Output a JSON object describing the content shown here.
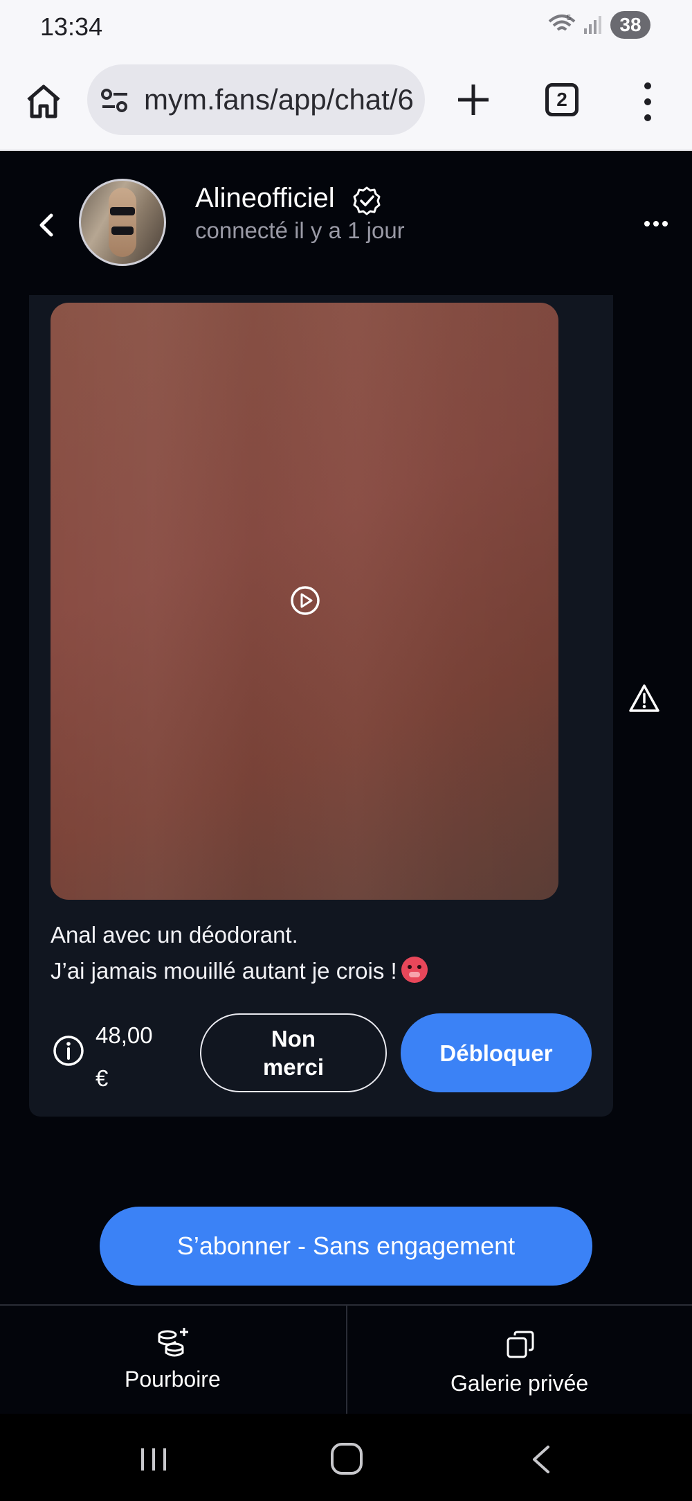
{
  "status_bar": {
    "time": "13:34",
    "battery": "38",
    "wifi_badge": "5"
  },
  "browser": {
    "url": "mym.fans/app/chat/6",
    "tab_count": "2"
  },
  "chat": {
    "username": "Alineofficiel",
    "last_seen": "connecté il y a 1 jour"
  },
  "message": {
    "caption_line1": "Anal avec un déodorant.",
    "caption_line2": "J’ai jamais mouillé autant je crois !",
    "price_amount": "48,00",
    "price_currency": "€",
    "decline_label": "Non merci",
    "unlock_label": "Débloquer"
  },
  "subscribe_label": "S’abonner - Sans engagement",
  "bottom_bar": {
    "tip_label": "Pourboire",
    "gallery_label": "Galerie privée"
  },
  "colors": {
    "accent": "#3b82f6",
    "background": "#03050b",
    "card": "#111620",
    "media": "#894c43"
  }
}
